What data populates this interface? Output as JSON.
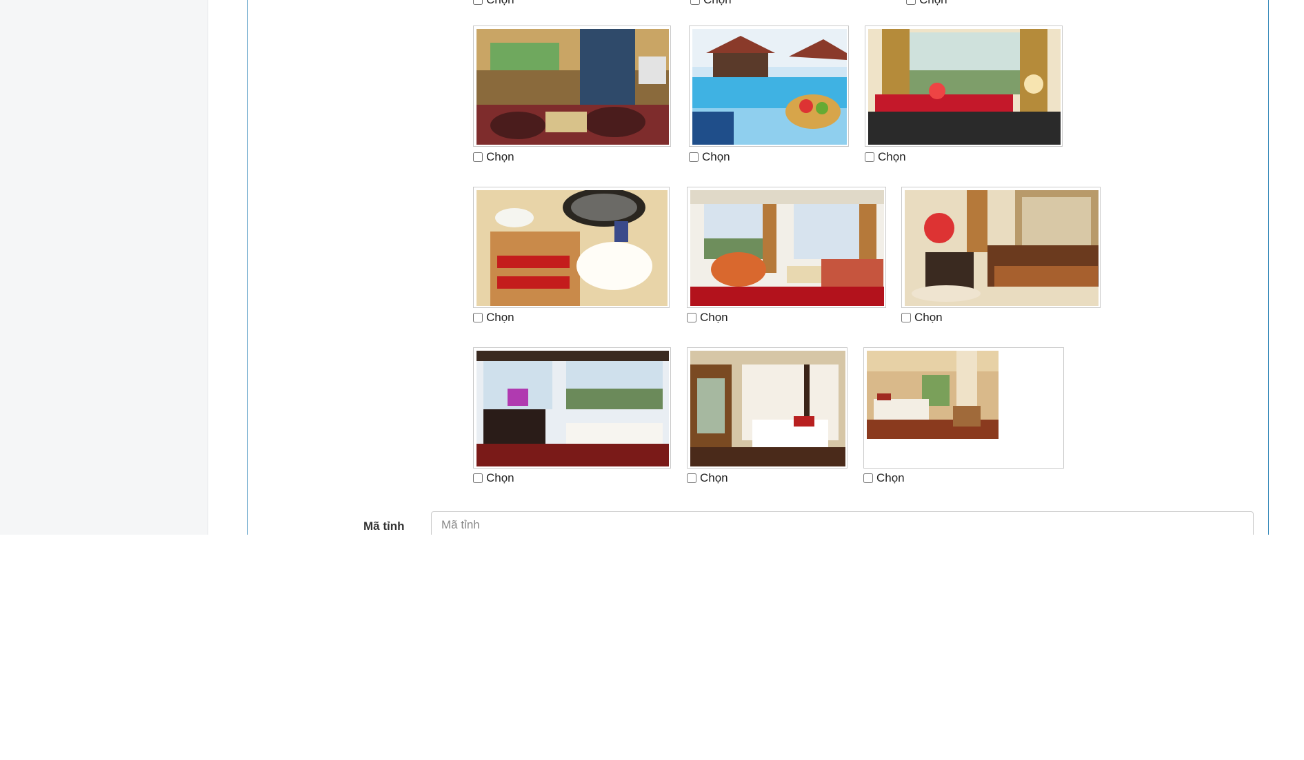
{
  "gallery": {
    "choose_label": "Chọn",
    "photos": [
      {
        "name": "lounge-bar-photo"
      },
      {
        "name": "rooftop-pool-photo"
      },
      {
        "name": "window-seating-photo"
      },
      {
        "name": "bathroom-vanity-photo"
      },
      {
        "name": "suite-living-room-photo"
      },
      {
        "name": "sofa-dining-photo"
      },
      {
        "name": "river-view-bedroom-photo"
      },
      {
        "name": "canopy-bed-photo"
      },
      {
        "name": "twin-room-photo"
      }
    ]
  },
  "form": {
    "ma_tinh_label": "Mã tỉnh",
    "ma_tinh_placeholder": "Mã tỉnh",
    "ma_tinh_value": ""
  },
  "colors": {
    "panel_border": "#3c8dbc",
    "sidebar_bg": "#f5f6f7"
  }
}
